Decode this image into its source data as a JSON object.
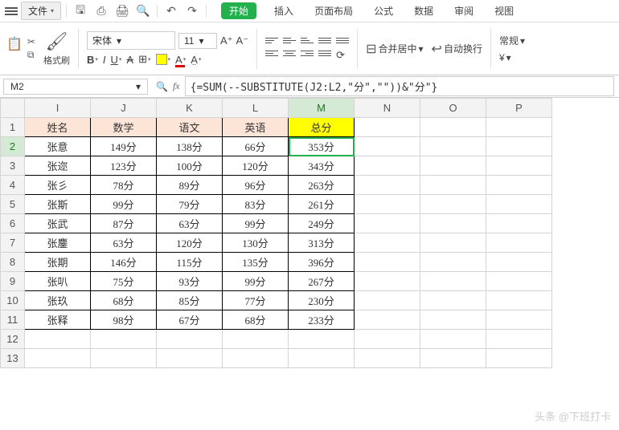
{
  "menubar": {
    "file_label": "文件",
    "tabs": [
      "开始",
      "插入",
      "页面布局",
      "公式",
      "数据",
      "审阅",
      "视图"
    ],
    "active_tab_index": 0
  },
  "ribbon": {
    "format_painter": "格式刷",
    "font_name": "宋体",
    "font_size": "11",
    "merge_center": "合并居中",
    "wrap_text": "自动换行",
    "general": "常规"
  },
  "fxbar": {
    "cell_ref": "M2",
    "formula": "{=SUM(--SUBSTITUTE(J2:L2,\"分\",\"\"))&\"分\"}"
  },
  "grid": {
    "cols": [
      "I",
      "J",
      "K",
      "L",
      "M",
      "N",
      "O",
      "P"
    ],
    "selected_col": "M",
    "selected_row": 2,
    "headers": {
      "I": "姓名",
      "J": "数学",
      "K": "语文",
      "L": "英语",
      "M": "总分"
    },
    "rows": [
      {
        "n": 2,
        "I": "张意",
        "J": "149分",
        "K": "138分",
        "L": "66分",
        "M": "353分"
      },
      {
        "n": 3,
        "I": "张迩",
        "J": "123分",
        "K": "100分",
        "L": "120分",
        "M": "343分"
      },
      {
        "n": 4,
        "I": "张彡",
        "J": "78分",
        "K": "89分",
        "L": "96分",
        "M": "263分"
      },
      {
        "n": 5,
        "I": "张斯",
        "J": "99分",
        "K": "79分",
        "L": "83分",
        "M": "261分"
      },
      {
        "n": 6,
        "I": "张武",
        "J": "87分",
        "K": "63分",
        "L": "99分",
        "M": "249分"
      },
      {
        "n": 7,
        "I": "张鏖",
        "J": "63分",
        "K": "120分",
        "L": "130分",
        "M": "313分"
      },
      {
        "n": 8,
        "I": "张期",
        "J": "146分",
        "K": "115分",
        "L": "135分",
        "M": "396分"
      },
      {
        "n": 9,
        "I": "张叭",
        "J": "75分",
        "K": "93分",
        "L": "99分",
        "M": "267分"
      },
      {
        "n": 10,
        "I": "张玖",
        "J": "68分",
        "K": "85分",
        "L": "77分",
        "M": "230分"
      },
      {
        "n": 11,
        "I": "张释",
        "J": "98分",
        "K": "67分",
        "L": "68分",
        "M": "233分"
      }
    ],
    "empty_rows": [
      12,
      13
    ]
  },
  "watermark": "头条 @下班打卡"
}
